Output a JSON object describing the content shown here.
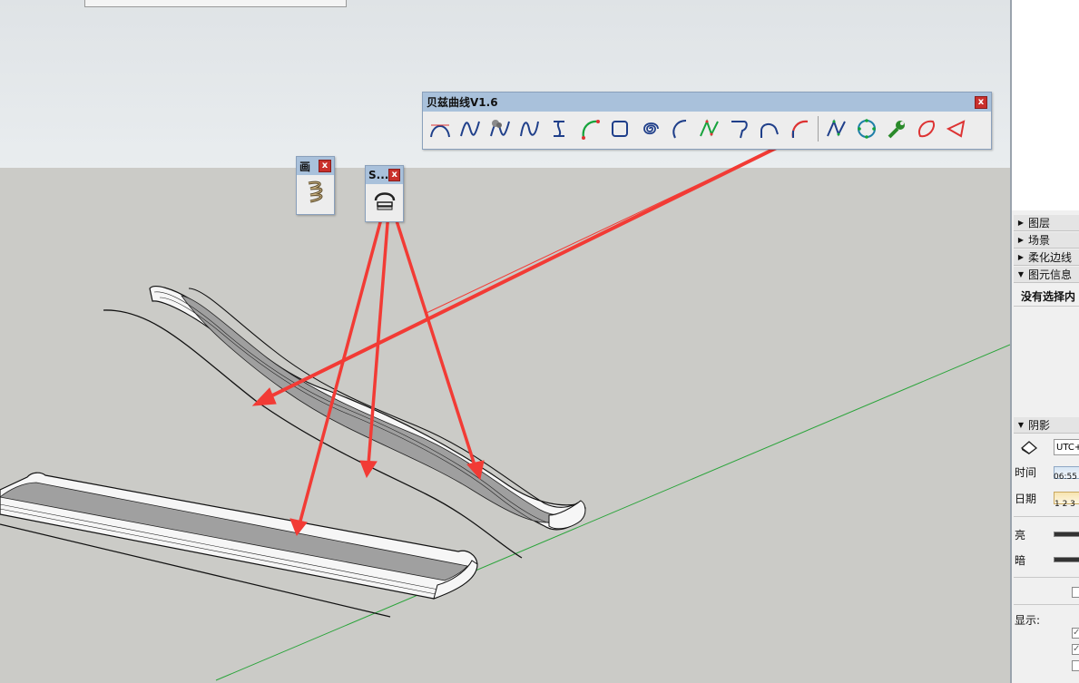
{
  "bezier_toolbar": {
    "title": "贝兹曲线V1.6",
    "close_label": "x",
    "tools": [
      "arc-curve-tool",
      "bezier-curve-tool",
      "polyline-bezier-tool",
      "spline-tool",
      "catmull-spline-tool",
      "arc-tool",
      "rectangle-tool",
      "spiral-tool",
      "arc-three-point-tool",
      "zigzag-tool",
      "hook-curve-tool",
      "corner-arc-tool",
      "red-arc-tool",
      "polyline-tool",
      "polygon-tool",
      "wrench-settings-tool",
      "closed-curve-tool",
      "triangle-tool"
    ]
  },
  "draw_toolbar": {
    "title": "画",
    "close_label": "x",
    "tool": "spring-coil-tool"
  },
  "s_toolbar": {
    "title": "S...",
    "close_label": "x",
    "tool": "follow-shape-tool"
  },
  "tray": {
    "sections": [
      {
        "label": "图层",
        "collapsed": true
      },
      {
        "label": "场景",
        "collapsed": true
      },
      {
        "label": "柔化边线",
        "collapsed": true
      },
      {
        "label": "图元信息",
        "collapsed": false
      }
    ],
    "entity_info_text": "没有选择内",
    "shadow": {
      "label": "阴影",
      "timezone": "UTC+",
      "time_label": "时间",
      "time_value": "06:55",
      "date_label": "日期",
      "date_ticks": "1 2 3",
      "light_label": "亮",
      "dark_label": "暗",
      "display_label": "显示:"
    }
  },
  "colors": {
    "annotation_arrow": "#f23b35",
    "green_axis": "#2aa43a",
    "toolbar_title": "#a9c1db"
  }
}
